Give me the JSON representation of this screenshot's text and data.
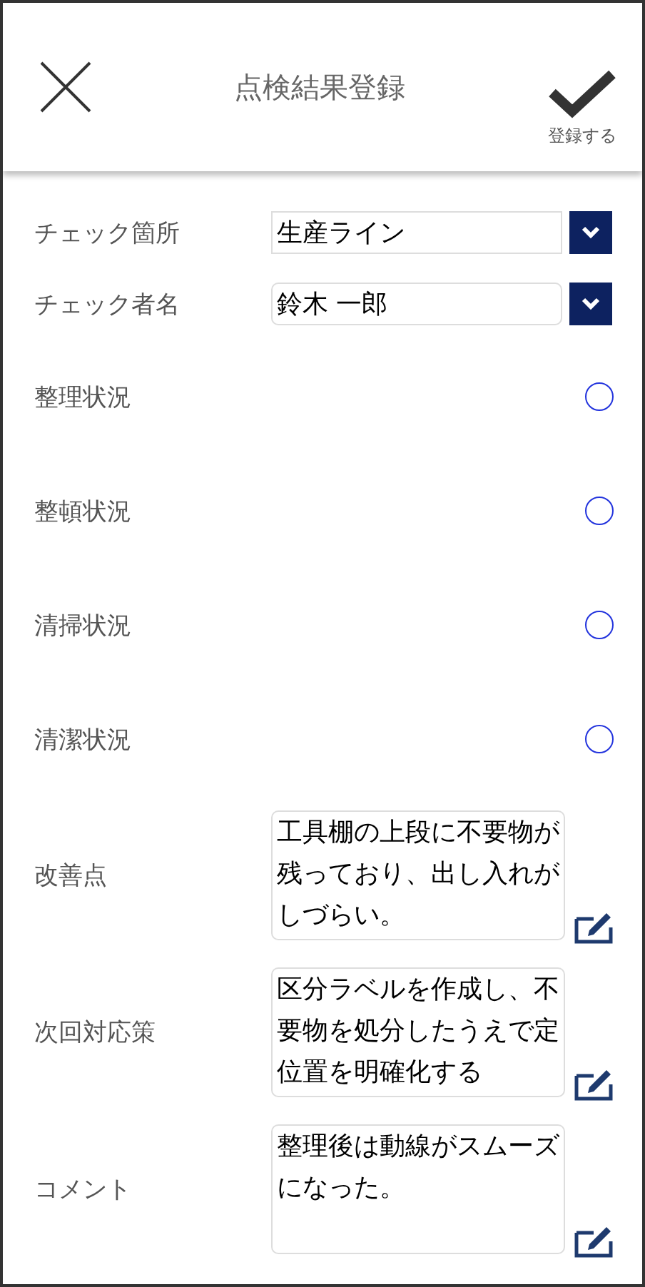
{
  "header": {
    "title": "点検結果登録",
    "confirm_label": "登録する"
  },
  "fields": [
    {
      "kind": "select",
      "label": "チェック箇所",
      "value": "生産ライン"
    },
    {
      "kind": "select",
      "label": "チェック者名",
      "value": "鈴木 一郎"
    },
    {
      "kind": "radio",
      "label": "整理状況",
      "selected": false
    },
    {
      "kind": "radio",
      "label": "整頓状況",
      "selected": false
    },
    {
      "kind": "radio",
      "label": "清掃状況",
      "selected": false
    },
    {
      "kind": "radio",
      "label": "清潔状況",
      "selected": false
    },
    {
      "kind": "text",
      "label": "改善点",
      "value": "工具棚の上段に不要物が残っており、出し入れがしづらい。"
    },
    {
      "kind": "text",
      "label": "次回対応策",
      "value": "区分ラベルを作成し、不要物を処分したうえで定位置を明確化する"
    },
    {
      "kind": "text",
      "label": "コメント",
      "value": "整理後は動線がスムーズになった。"
    }
  ]
}
